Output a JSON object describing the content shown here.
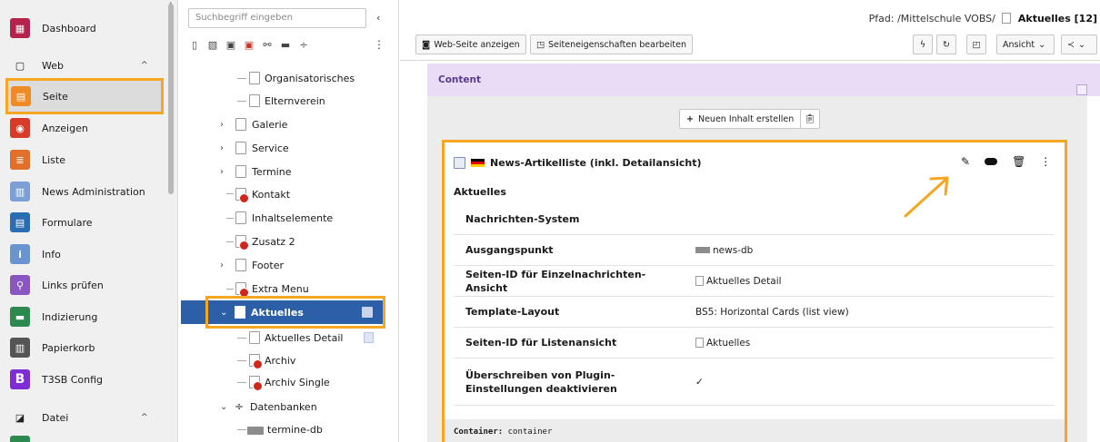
{
  "modules": [
    {
      "label": "Dashboard",
      "icon": "dashboard-icon",
      "color": "#b5224c",
      "glyph": "▦"
    },
    {
      "label": "Web",
      "icon": "file-icon",
      "section": true,
      "glyph": "▢",
      "chevron": "^"
    },
    {
      "label": "Seite",
      "icon": "page-icon",
      "color": "#f08a24",
      "glyph": "▤",
      "active": true
    },
    {
      "label": "Anzeigen",
      "icon": "eye-icon",
      "color": "#d93b2b",
      "glyph": "◉"
    },
    {
      "label": "Liste",
      "icon": "list-icon",
      "color": "#e0702a",
      "glyph": "≣"
    },
    {
      "label": "News Administration",
      "icon": "news-icon",
      "color": "#7b9fd6",
      "glyph": "▥"
    },
    {
      "label": "Formulare",
      "icon": "form-icon",
      "color": "#2b6db3",
      "glyph": "▤"
    },
    {
      "label": "Info",
      "icon": "info-icon",
      "color": "#6a93d1",
      "glyph": "i"
    },
    {
      "label": "Links prüfen",
      "icon": "link-icon",
      "color": "#8a56c2",
      "glyph": "⚲"
    },
    {
      "label": "Indizierung",
      "icon": "index-icon",
      "color": "#2d8a4e",
      "glyph": "▬"
    },
    {
      "label": "Papierkorb",
      "icon": "trash-icon",
      "color": "#555555",
      "glyph": "▥"
    },
    {
      "label": "T3SB Config",
      "icon": "bootstrap-icon",
      "color": "#7f2bd6",
      "glyph": "B"
    },
    {
      "label": "Datei",
      "icon": "image-icon",
      "section": true,
      "glyph": "◪",
      "chevron": "^"
    }
  ],
  "tree": {
    "search_placeholder": "Suchbegriff eingeben",
    "collapse": "‹",
    "more": "⋮",
    "items": [
      {
        "label": "Organisatorisches"
      },
      {
        "label": "Elternverein"
      },
      {
        "label": "Galerie"
      },
      {
        "label": "Service"
      },
      {
        "label": "Termine"
      },
      {
        "label": "Kontakt"
      },
      {
        "label": "Inhaltselemente"
      },
      {
        "label": "Zusatz 2"
      },
      {
        "label": "Footer"
      },
      {
        "label": "Extra Menu"
      },
      {
        "label": "Aktuelles"
      },
      {
        "label": "Aktuelles Detail"
      },
      {
        "label": "Archiv"
      },
      {
        "label": "Archiv Single"
      },
      {
        "label": "Datenbanken"
      },
      {
        "label": "termine-db"
      }
    ]
  },
  "header": {
    "path_prefix": "Pfad: /Mittelschule VOBS/",
    "path_page": "Aktuelles [12]",
    "view_page": "Web-Seite anzeigen",
    "edit_props": "Seiteneigenschaften bearbeiten",
    "ansicht": "Ansicht"
  },
  "content": {
    "column_title": "Content",
    "new_content": "Neuen Inhalt erstellen",
    "element_title": "News-Artikelliste (inkl. Detailansicht)",
    "subtitle": "Aktuelles",
    "properties": [
      {
        "key": "Nachrichten-System",
        "value": ""
      },
      {
        "key": "Ausgangspunkt",
        "value": "news-db"
      },
      {
        "key": "Seiten-ID für Einzelnachrichten-Ansicht",
        "value": "Aktuelles Detail"
      },
      {
        "key": "Template-Layout",
        "value": "BS5: Horizontal Cards (list view)"
      },
      {
        "key": "Seiten-ID für Listenansicht",
        "value": "Aktuelles"
      },
      {
        "key": "Überschreiben von Plugin-Einstellungen deaktivieren",
        "value": "✓"
      }
    ],
    "container_label": "Container:",
    "container_value": "container"
  },
  "colors": {
    "highlight": "#f5a623",
    "selected": "#2c5fa8",
    "column_header": "#eadcf7"
  }
}
